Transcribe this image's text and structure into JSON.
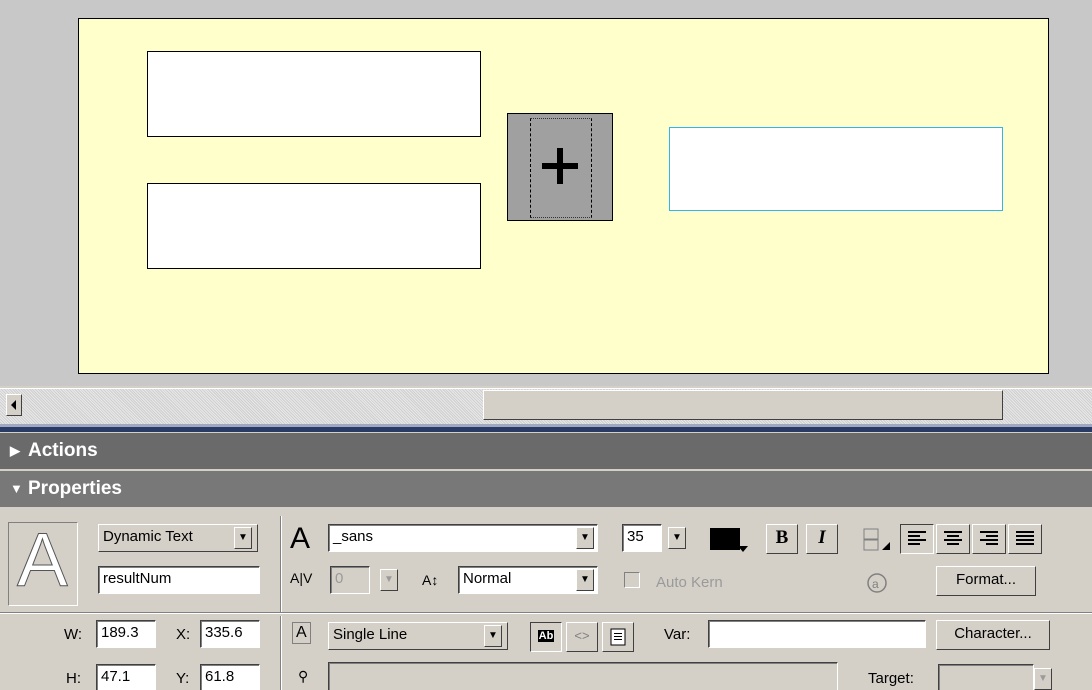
{
  "stage": {
    "plus_symbol": "+"
  },
  "panels": {
    "actions_title": "Actions",
    "properties_title": "Properties"
  },
  "properties": {
    "text_type": "Dynamic Text",
    "instance_name": "resultNum",
    "font": "_sans",
    "font_size": "35",
    "text_color": "#000000",
    "bold_label": "B",
    "italic_label": "I",
    "tracking_value": "0",
    "baseline_value": "Normal",
    "auto_kern_label": "Auto Kern",
    "format_button": "Format...",
    "width_label": "W:",
    "width_value": "189.3",
    "x_label": "X:",
    "x_value": "335.6",
    "height_label": "H:",
    "height_value": "47.1",
    "y_label": "Y:",
    "y_value": "61.8",
    "line_type": "Single Line",
    "var_label": "Var:",
    "var_value": "",
    "character_button": "Character...",
    "target_label": "Target:",
    "url_value": ""
  },
  "icons": {
    "text_tool": "text-tool-icon",
    "font": "font-icon",
    "tracking": "char-spacing-icon",
    "baseline": "baseline-shift-icon",
    "line_type": "line-type-icon",
    "selectable": "selectable-icon",
    "html": "render-html-icon",
    "border": "show-border-icon",
    "link": "url-link-icon",
    "text_direction": "text-direction-icon",
    "rotate": "rotate-icon"
  }
}
